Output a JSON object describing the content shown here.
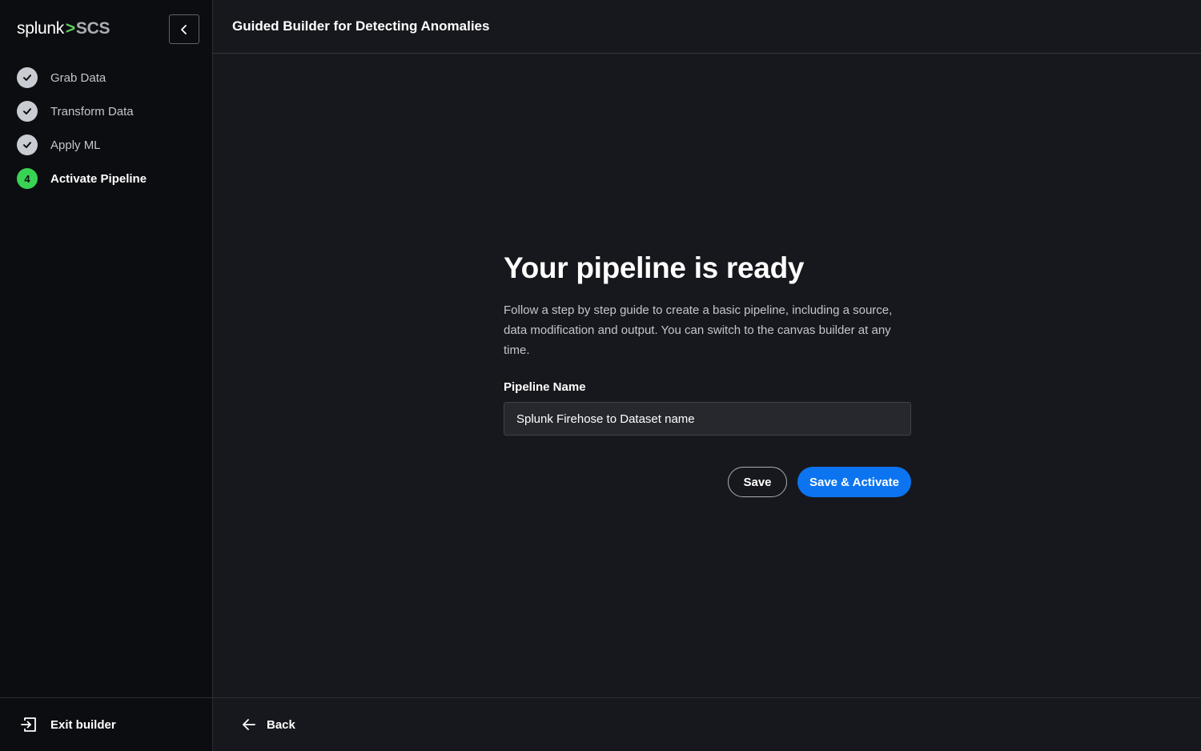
{
  "brand": {
    "name": "splunk",
    "separator": ">",
    "product": "SCS"
  },
  "sidebar": {
    "collapse_icon": "chevron-left-icon",
    "steps": [
      {
        "label": "Grab Data",
        "status": "complete",
        "icon": "check-icon"
      },
      {
        "label": "Transform Data",
        "status": "complete",
        "icon": "check-icon"
      },
      {
        "label": "Apply ML",
        "status": "complete",
        "icon": "check-icon"
      },
      {
        "label": "Activate Pipeline",
        "status": "current",
        "number": "4"
      }
    ],
    "exit_label": "Exit builder",
    "exit_icon": "exit-icon"
  },
  "header": {
    "title": "Guided Builder for Detecting Anomalies"
  },
  "main": {
    "heading": "Your pipeline is ready",
    "description": "Follow a step by step guide to create a basic pipeline, including a source, data modification and output. You can switch to the canvas builder at any time.",
    "pipeline_name_label": "Pipeline Name",
    "pipeline_name_value": "Splunk Firehose to Dataset name",
    "save_label": "Save",
    "save_activate_label": "Save & Activate"
  },
  "footer": {
    "back_label": "Back",
    "back_icon": "arrow-left-icon"
  },
  "colors": {
    "background": "#17181d",
    "sidebar": "#0c0d10",
    "accent_green": "#39d353",
    "primary_blue": "#0c74f0",
    "brand_chevron": "#5dd15f"
  }
}
